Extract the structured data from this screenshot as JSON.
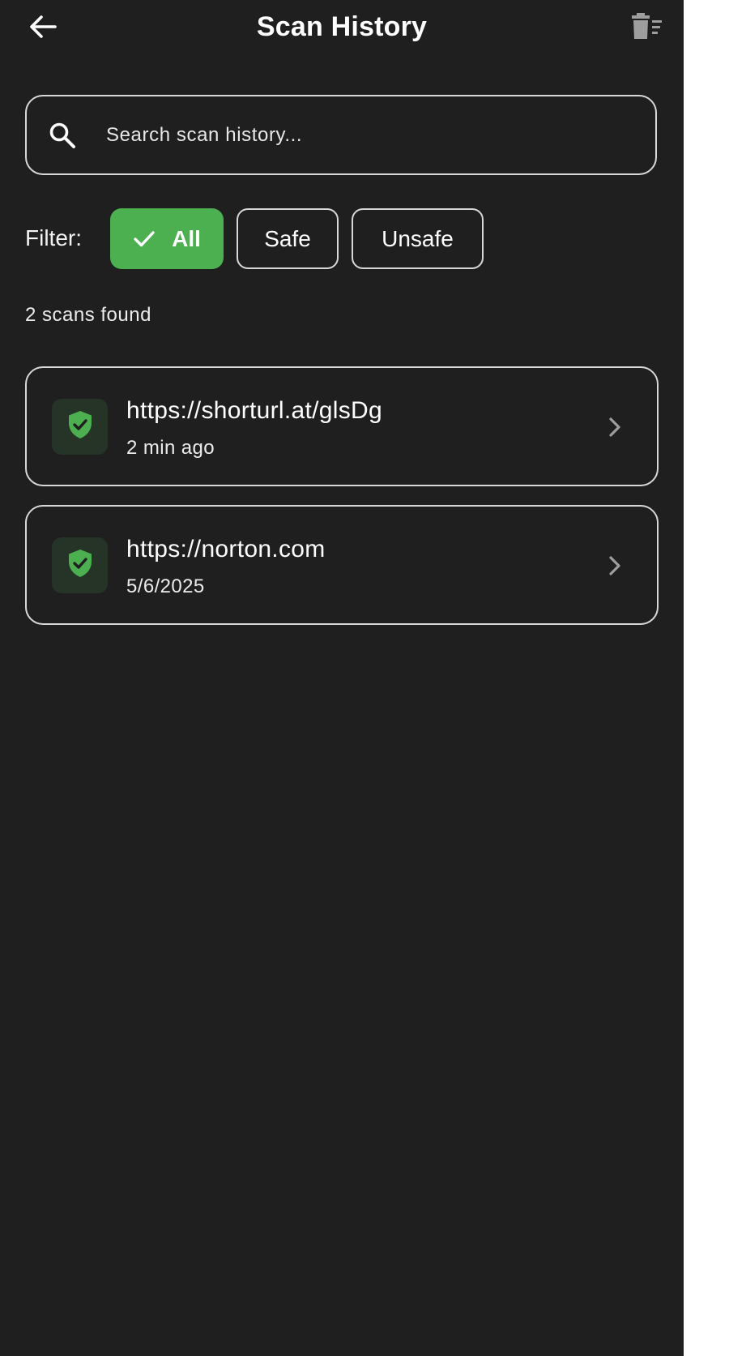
{
  "header": {
    "title": "Scan History",
    "back_icon": "arrow-left-icon",
    "delete_icon": "clear-history-icon"
  },
  "search": {
    "placeholder": "Search scan history...",
    "value": "",
    "icon": "search-icon"
  },
  "filter": {
    "label": "Filter:",
    "options": [
      {
        "label": "All",
        "selected": true
      },
      {
        "label": "Safe",
        "selected": false
      },
      {
        "label": "Unsafe",
        "selected": false
      }
    ]
  },
  "results": {
    "count_text": "2 scans found",
    "items": [
      {
        "url": "https://shorturl.at/glsDg",
        "time": "2 min ago",
        "status": "safe"
      },
      {
        "url": "https://norton.com",
        "time": "5/6/2025",
        "status": "safe"
      }
    ]
  },
  "colors": {
    "background": "#1f1f1f",
    "accent_green": "#4caf50",
    "border": "#d8d8d8",
    "safe_tile": "#263327"
  }
}
